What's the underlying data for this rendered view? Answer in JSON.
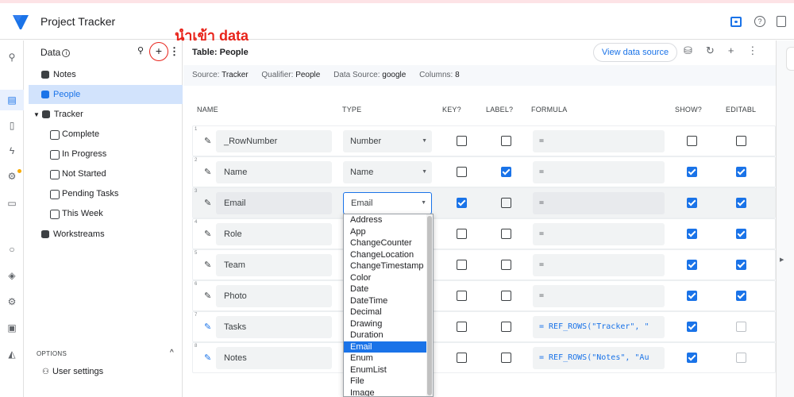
{
  "app": {
    "title": "Project Tracker"
  },
  "annotation": "นำเข้า data",
  "header_icons": [
    "preview-icon",
    "help-icon",
    "docs-icon"
  ],
  "data_panel": {
    "title": "Data",
    "tree": [
      {
        "label": "Notes",
        "indent": 0,
        "icon": "database-icon"
      },
      {
        "label": "People",
        "indent": 0,
        "icon": "database-icon",
        "selected": true
      },
      {
        "label": "Tracker",
        "indent": 0,
        "icon": "database-icon",
        "expanded": true
      },
      {
        "label": "Complete",
        "indent": 1,
        "icon": "slice-icon"
      },
      {
        "label": "In Progress",
        "indent": 1,
        "icon": "slice-icon"
      },
      {
        "label": "Not Started",
        "indent": 1,
        "icon": "slice-icon"
      },
      {
        "label": "Pending Tasks",
        "indent": 1,
        "icon": "slice-icon"
      },
      {
        "label": "This Week",
        "indent": 1,
        "icon": "slice-icon"
      },
      {
        "label": "Workstreams",
        "indent": 0,
        "icon": "database-icon"
      }
    ],
    "options_label": "OPTIONS",
    "user_settings": "User settings"
  },
  "table": {
    "title": "Table: People",
    "view_button": "View data source",
    "meta": {
      "source_label": "Source:",
      "source": "Tracker",
      "qualifier_label": "Qualifier:",
      "qualifier": "People",
      "datasource_label": "Data Source:",
      "datasource": "google",
      "columns_label": "Columns:",
      "columns": "8"
    },
    "headers": [
      "NAME",
      "TYPE",
      "KEY?",
      "LABEL?",
      "FORMULA",
      "SHOW?",
      "EDITABL"
    ],
    "rows": [
      {
        "num": "1",
        "name": "_RowNumber",
        "type": "Number",
        "key": false,
        "label": false,
        "formula": "=",
        "show": false,
        "editable": false
      },
      {
        "num": "2",
        "name": "Name",
        "type": "Name",
        "key": false,
        "label": true,
        "formula": "=",
        "show": true,
        "editable": true
      },
      {
        "num": "3",
        "name": "Email",
        "type": "Email",
        "key": true,
        "label": false,
        "formula": "=",
        "show": true,
        "editable": true
      },
      {
        "num": "4",
        "name": "Role",
        "type": "",
        "key": false,
        "label": false,
        "formula": "=",
        "show": true,
        "editable": true
      },
      {
        "num": "5",
        "name": "Team",
        "type": "",
        "key": false,
        "label": false,
        "formula": "=",
        "show": true,
        "editable": true
      },
      {
        "num": "6",
        "name": "Photo",
        "type": "",
        "key": false,
        "label": false,
        "formula": "=",
        "show": true,
        "editable": true
      },
      {
        "num": "7",
        "name": "Tasks",
        "type": "",
        "key": false,
        "label": false,
        "formula": "= REF_ROWS(\"Tracker\", \"",
        "show": true,
        "editable": false
      },
      {
        "num": "8",
        "name": "Notes",
        "type": "",
        "key": false,
        "label": false,
        "formula": "= REF_ROWS(\"Notes\", \"Au",
        "show": true,
        "editable": false
      }
    ]
  },
  "type_dropdown": {
    "options": [
      "Address",
      "App",
      "ChangeCounter",
      "ChangeLocation",
      "ChangeTimestamp",
      "Color",
      "Date",
      "DateTime",
      "Decimal",
      "Drawing",
      "Duration",
      "Email",
      "Enum",
      "EnumList",
      "File",
      "Image"
    ],
    "selected": "Email"
  },
  "colors": {
    "accent": "#1a73e8",
    "annotation": "#e8231a",
    "selected_bg": "#d2e3fc"
  }
}
